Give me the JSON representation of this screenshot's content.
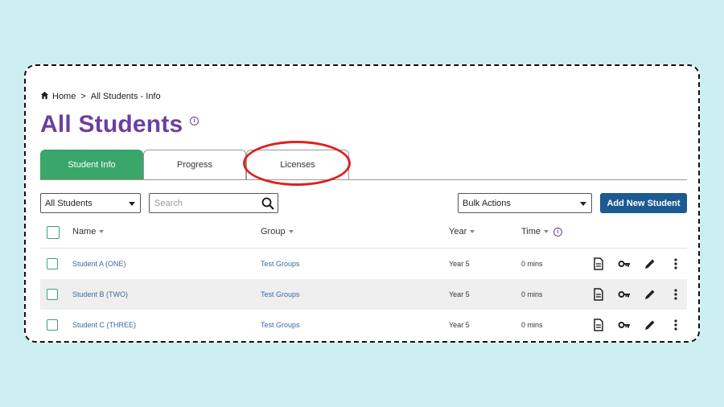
{
  "breadcrumb": {
    "home": "Home",
    "separator": ">",
    "current": "All Students - Info"
  },
  "page": {
    "title": "All Students",
    "info_icon": "info-icon"
  },
  "tabs": [
    {
      "label": "Student Info",
      "active": true
    },
    {
      "label": "Progress",
      "active": false
    },
    {
      "label": "Licenses",
      "active": false
    }
  ],
  "filters": {
    "student_filter": "All Students",
    "search_placeholder": "Search",
    "bulk_actions": "Bulk Actions",
    "add_button": "Add New Student"
  },
  "table": {
    "headers": {
      "name": "Name",
      "group": "Group",
      "year": "Year",
      "time": "Time"
    },
    "rows": [
      {
        "name": "Student A (ONE)",
        "group": "Test Groups",
        "year": "Year 5",
        "time": "0 mins"
      },
      {
        "name": "Student B (TWO)",
        "group": "Test Groups",
        "year": "Year 5",
        "time": "0 mins"
      },
      {
        "name": "Student C (THREE)",
        "group": "Test Groups",
        "year": "Year 5",
        "time": "0 mins"
      }
    ]
  },
  "colors": {
    "title": "#6b3fa0",
    "active_tab": "#3aa66a",
    "primary_button": "#1c5a91",
    "link": "#3a6aa0",
    "annotation": "#e02020",
    "background": "#cdeff1"
  },
  "icons": [
    "home-icon",
    "info-icon",
    "search-icon",
    "document-icon",
    "key-icon",
    "pencil-icon",
    "more-vertical-icon"
  ]
}
